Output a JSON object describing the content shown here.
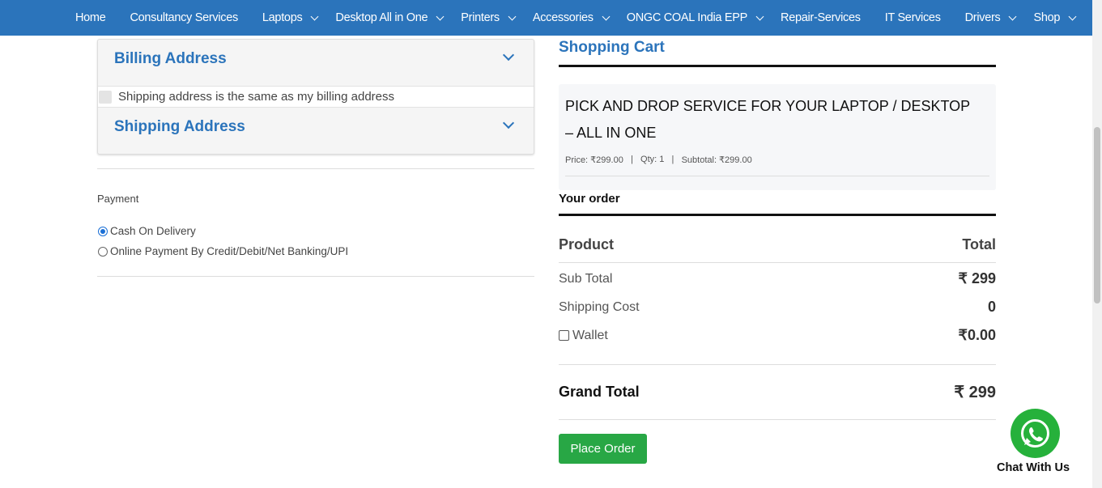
{
  "nav": {
    "items": [
      {
        "label": "Home",
        "dropdown": false
      },
      {
        "label": "Consultancy Services",
        "dropdown": false
      },
      {
        "label": "Laptops",
        "dropdown": true
      },
      {
        "label": "Desktop All in One",
        "dropdown": true
      },
      {
        "label": "Printers",
        "dropdown": true
      },
      {
        "label": "Accessories",
        "dropdown": true
      },
      {
        "label": "ONGC COAL India EPP",
        "dropdown": true
      },
      {
        "label": "Repair-Services",
        "dropdown": false
      },
      {
        "label": "IT Services",
        "dropdown": false
      },
      {
        "label": "Drivers",
        "dropdown": true
      },
      {
        "label": "Shop",
        "dropdown": true
      }
    ],
    "bg_color": "#2b74bb"
  },
  "checkout": {
    "billing_title": "Billing Address",
    "same_address_label": "Shipping address is the same as my billing address",
    "shipping_title": "Shipping Address",
    "payment_title": "Payment",
    "payment_options": [
      {
        "label": "Cash On Delivery",
        "selected": true
      },
      {
        "label": "Online Payment By Credit/Debit/Net Banking/UPI",
        "selected": false
      }
    ]
  },
  "cart": {
    "title": "Shopping Cart",
    "item": {
      "name": "PICK AND DROP SERVICE FOR YOUR LAPTOP / DESKTOP – ALL IN ONE",
      "price": "Price: ₹299.00",
      "qty": "Qty: 1",
      "subtotal": "Subtotal: ₹299.00",
      "sep": "|"
    }
  },
  "order": {
    "title": "Your order",
    "col_product": "Product",
    "col_total": "Total",
    "sub_total_label": "Sub Total",
    "sub_total_value": "₹ 299",
    "shipping_label": "Shipping Cost",
    "shipping_value": "0",
    "wallet_label": "Wallet",
    "wallet_value": "₹0.00",
    "grand_total_label": "Grand Total",
    "grand_total_value": "₹ 299",
    "place_order": "Place Order"
  },
  "chat": {
    "label": "Chat With Us",
    "icon": "whatsapp-icon",
    "color": "#26b13b"
  },
  "colors": {
    "brand": "#2b74bb",
    "button": "#28a745"
  }
}
